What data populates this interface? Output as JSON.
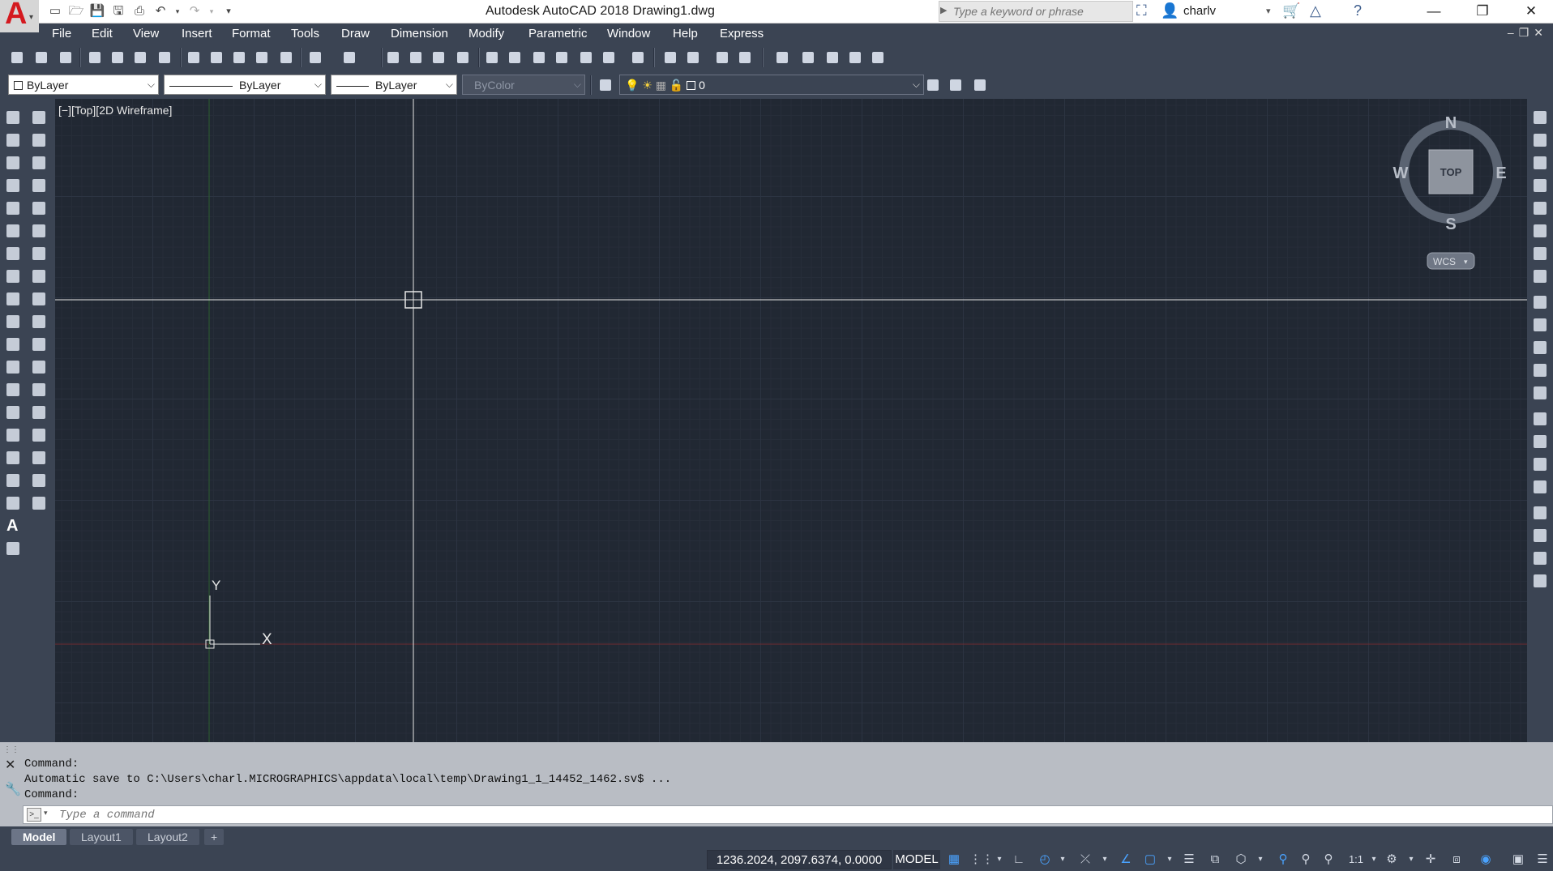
{
  "app": {
    "title": "Autodesk AutoCAD 2018",
    "document": "Drawing1.dwg",
    "title_line": "Autodesk AutoCAD 2018    Drawing1.dwg",
    "logo_letter": "A"
  },
  "search": {
    "placeholder": "Type a keyword or phrase"
  },
  "user": {
    "name": "charlv"
  },
  "window_controls": {
    "minimize": "—",
    "restore": "❐",
    "close": "✕"
  },
  "menu": {
    "items": [
      "File",
      "Edit",
      "View",
      "Insert",
      "Format",
      "Tools",
      "Draw",
      "Dimension",
      "Modify",
      "Parametric",
      "Window",
      "Help",
      "Express"
    ]
  },
  "properties": {
    "color": "ByLayer",
    "linetype": "ByLayer",
    "lineweight": "ByLayer",
    "plotstyle": "ByColor",
    "layer": "0"
  },
  "viewport": {
    "label": "[−][Top][2D Wireframe]"
  },
  "viewcube": {
    "north": "N",
    "south": "S",
    "east": "E",
    "west": "W",
    "face": "TOP",
    "ucs_label": "WCS"
  },
  "ucs_icon": {
    "x_label": "X",
    "y_label": "Y"
  },
  "command": {
    "history": [
      "Command:",
      "Automatic save to C:\\Users\\charl.MICROGRAPHICS\\appdata\\local\\temp\\Drawing1_1_14452_1462.sv$ ...",
      "Command:"
    ],
    "placeholder": "Type a command"
  },
  "layout_tabs": [
    "Model",
    "Layout1",
    "Layout2"
  ],
  "add_tab": "+",
  "status": {
    "coordinates": "1236.2024, 2097.6374, 0.0000",
    "space": "MODEL",
    "annotation_scale": "1:1"
  },
  "colors": {
    "background": "#3b4453",
    "canvas": "#212833",
    "logo_red": "#d4191f",
    "crosshair": "#e6e6e6",
    "x_axis": "#7a2a2a",
    "y_axis": "#2a6a2a"
  }
}
